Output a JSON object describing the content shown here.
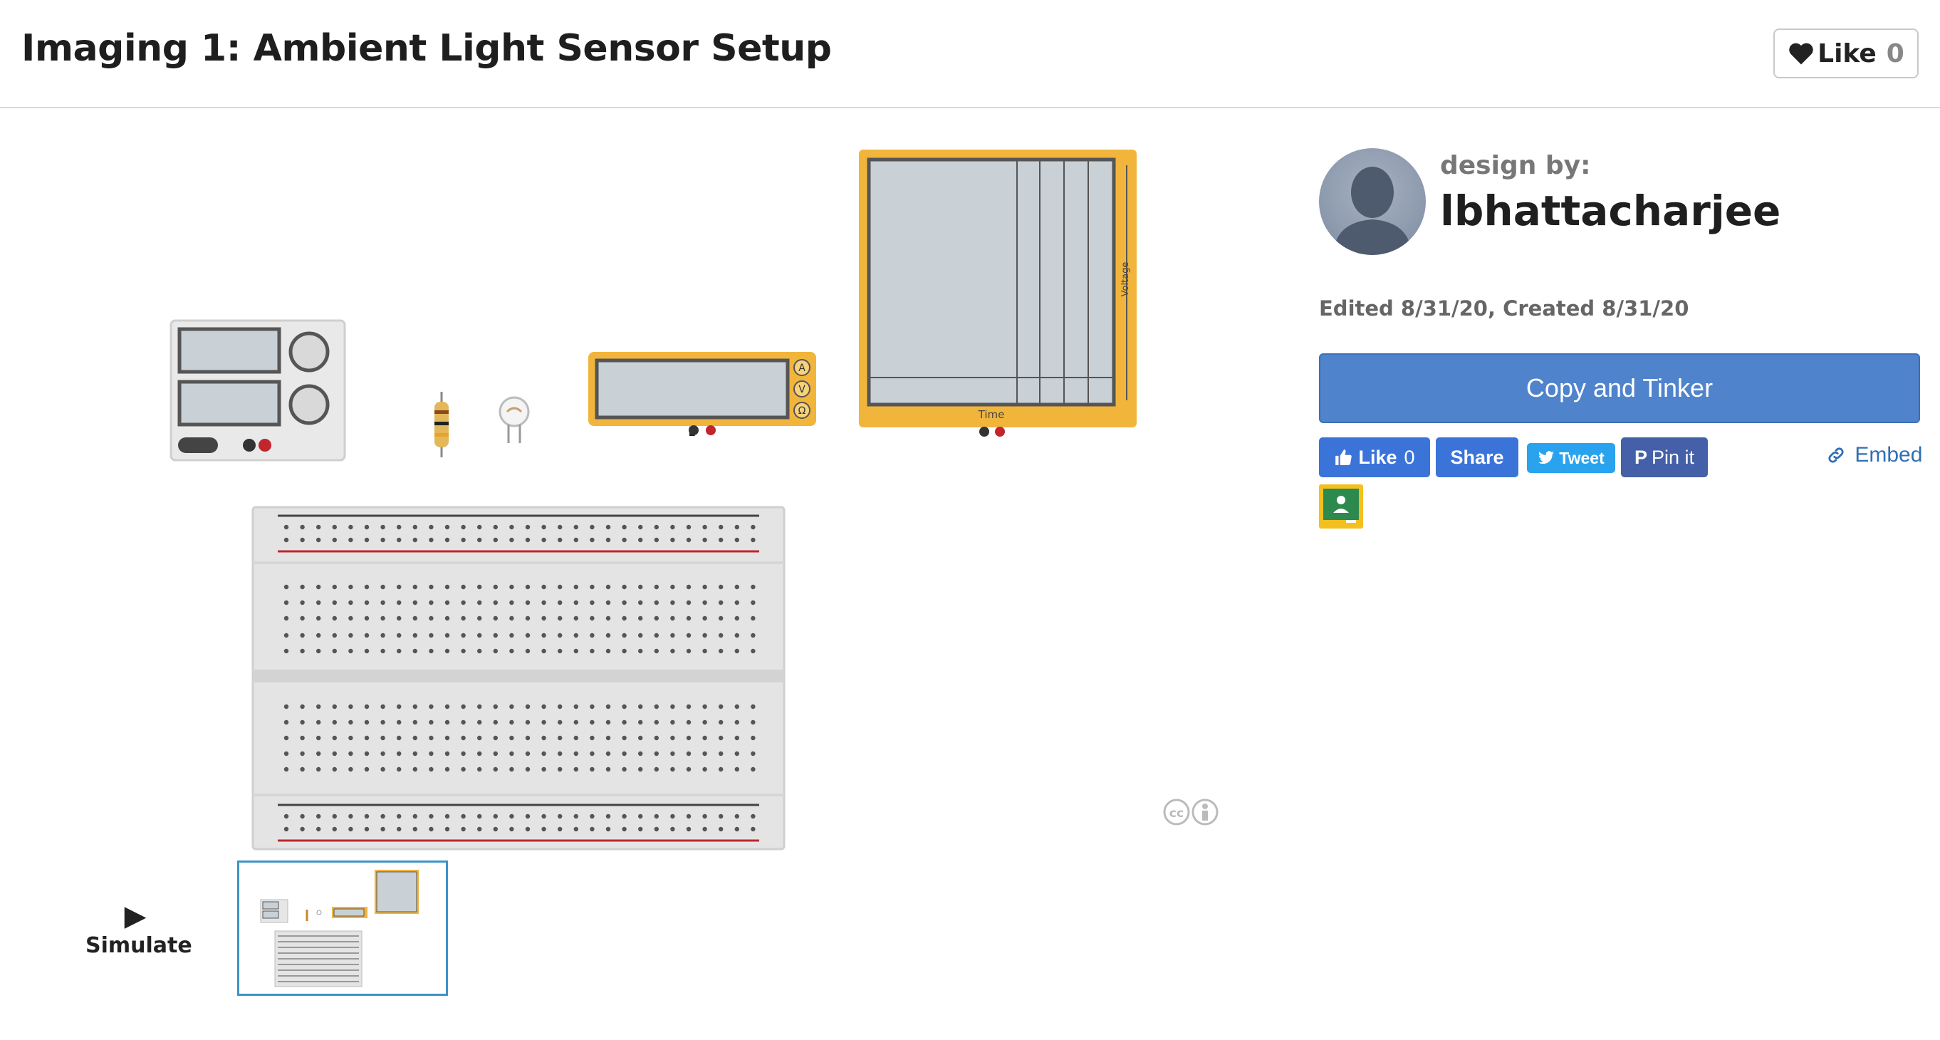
{
  "header": {
    "title": "Imaging 1: Ambient Light Sensor Setup",
    "like_label": "Like",
    "like_count": "0"
  },
  "designer": {
    "label": "design by:",
    "username": "lbhattacharjee",
    "dates": "Edited 8/31/20, Created 8/31/20"
  },
  "actions": {
    "copy_tinker": "Copy and Tinker",
    "fb_like": "Like",
    "fb_like_count": "0",
    "share": "Share",
    "tweet": "Tweet",
    "pin": "Pin it",
    "embed": "Embed"
  },
  "canvas": {
    "meter_modes": [
      "A",
      "V",
      "Ω"
    ],
    "oscilloscope_xlabel": "Time",
    "oscilloscope_ylabel": "Voltage"
  },
  "simulate": {
    "label": "Simulate"
  },
  "colors": {
    "primary_button": "#4f83cc",
    "facebook": "#3b74d9",
    "twitter": "#2aa3ef",
    "pinterest": "#4360a8",
    "instrument_yellow": "#f1b53c",
    "screen_gray": "#c9d0d6"
  },
  "icons": {
    "heart": "heart-icon",
    "play": "play-icon",
    "link": "link-icon",
    "license": "creative-commons-icon"
  }
}
